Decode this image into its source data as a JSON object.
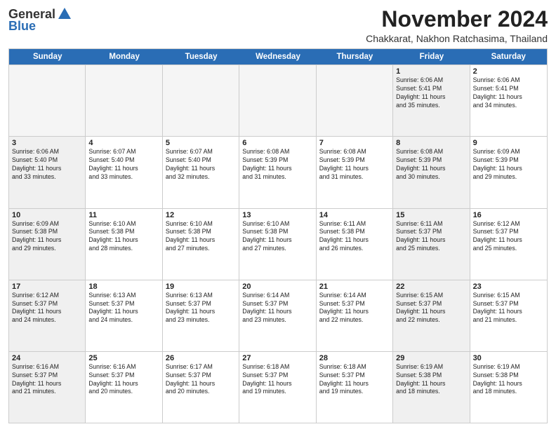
{
  "header": {
    "logo_line1": "General",
    "logo_line2": "Blue",
    "month": "November 2024",
    "location": "Chakkarat, Nakhon Ratchasima, Thailand"
  },
  "weekdays": [
    "Sunday",
    "Monday",
    "Tuesday",
    "Wednesday",
    "Thursday",
    "Friday",
    "Saturday"
  ],
  "rows": [
    [
      {
        "day": "",
        "info": "",
        "empty": true
      },
      {
        "day": "",
        "info": "",
        "empty": true
      },
      {
        "day": "",
        "info": "",
        "empty": true
      },
      {
        "day": "",
        "info": "",
        "empty": true
      },
      {
        "day": "",
        "info": "",
        "empty": true
      },
      {
        "day": "1",
        "info": "Sunrise: 6:06 AM\nSunset: 5:41 PM\nDaylight: 11 hours\nand 35 minutes.",
        "shaded": true
      },
      {
        "day": "2",
        "info": "Sunrise: 6:06 AM\nSunset: 5:41 PM\nDaylight: 11 hours\nand 34 minutes.",
        "shaded": false
      }
    ],
    [
      {
        "day": "3",
        "info": "Sunrise: 6:06 AM\nSunset: 5:40 PM\nDaylight: 11 hours\nand 33 minutes.",
        "shaded": true
      },
      {
        "day": "4",
        "info": "Sunrise: 6:07 AM\nSunset: 5:40 PM\nDaylight: 11 hours\nand 33 minutes.",
        "shaded": false
      },
      {
        "day": "5",
        "info": "Sunrise: 6:07 AM\nSunset: 5:40 PM\nDaylight: 11 hours\nand 32 minutes.",
        "shaded": false
      },
      {
        "day": "6",
        "info": "Sunrise: 6:08 AM\nSunset: 5:39 PM\nDaylight: 11 hours\nand 31 minutes.",
        "shaded": false
      },
      {
        "day": "7",
        "info": "Sunrise: 6:08 AM\nSunset: 5:39 PM\nDaylight: 11 hours\nand 31 minutes.",
        "shaded": false
      },
      {
        "day": "8",
        "info": "Sunrise: 6:08 AM\nSunset: 5:39 PM\nDaylight: 11 hours\nand 30 minutes.",
        "shaded": true
      },
      {
        "day": "9",
        "info": "Sunrise: 6:09 AM\nSunset: 5:39 PM\nDaylight: 11 hours\nand 29 minutes.",
        "shaded": false
      }
    ],
    [
      {
        "day": "10",
        "info": "Sunrise: 6:09 AM\nSunset: 5:38 PM\nDaylight: 11 hours\nand 29 minutes.",
        "shaded": true
      },
      {
        "day": "11",
        "info": "Sunrise: 6:10 AM\nSunset: 5:38 PM\nDaylight: 11 hours\nand 28 minutes.",
        "shaded": false
      },
      {
        "day": "12",
        "info": "Sunrise: 6:10 AM\nSunset: 5:38 PM\nDaylight: 11 hours\nand 27 minutes.",
        "shaded": false
      },
      {
        "day": "13",
        "info": "Sunrise: 6:10 AM\nSunset: 5:38 PM\nDaylight: 11 hours\nand 27 minutes.",
        "shaded": false
      },
      {
        "day": "14",
        "info": "Sunrise: 6:11 AM\nSunset: 5:38 PM\nDaylight: 11 hours\nand 26 minutes.",
        "shaded": false
      },
      {
        "day": "15",
        "info": "Sunrise: 6:11 AM\nSunset: 5:37 PM\nDaylight: 11 hours\nand 25 minutes.",
        "shaded": true
      },
      {
        "day": "16",
        "info": "Sunrise: 6:12 AM\nSunset: 5:37 PM\nDaylight: 11 hours\nand 25 minutes.",
        "shaded": false
      }
    ],
    [
      {
        "day": "17",
        "info": "Sunrise: 6:12 AM\nSunset: 5:37 PM\nDaylight: 11 hours\nand 24 minutes.",
        "shaded": true
      },
      {
        "day": "18",
        "info": "Sunrise: 6:13 AM\nSunset: 5:37 PM\nDaylight: 11 hours\nand 24 minutes.",
        "shaded": false
      },
      {
        "day": "19",
        "info": "Sunrise: 6:13 AM\nSunset: 5:37 PM\nDaylight: 11 hours\nand 23 minutes.",
        "shaded": false
      },
      {
        "day": "20",
        "info": "Sunrise: 6:14 AM\nSunset: 5:37 PM\nDaylight: 11 hours\nand 23 minutes.",
        "shaded": false
      },
      {
        "day": "21",
        "info": "Sunrise: 6:14 AM\nSunset: 5:37 PM\nDaylight: 11 hours\nand 22 minutes.",
        "shaded": false
      },
      {
        "day": "22",
        "info": "Sunrise: 6:15 AM\nSunset: 5:37 PM\nDaylight: 11 hours\nand 22 minutes.",
        "shaded": true
      },
      {
        "day": "23",
        "info": "Sunrise: 6:15 AM\nSunset: 5:37 PM\nDaylight: 11 hours\nand 21 minutes.",
        "shaded": false
      }
    ],
    [
      {
        "day": "24",
        "info": "Sunrise: 6:16 AM\nSunset: 5:37 PM\nDaylight: 11 hours\nand 21 minutes.",
        "shaded": true
      },
      {
        "day": "25",
        "info": "Sunrise: 6:16 AM\nSunset: 5:37 PM\nDaylight: 11 hours\nand 20 minutes.",
        "shaded": false
      },
      {
        "day": "26",
        "info": "Sunrise: 6:17 AM\nSunset: 5:37 PM\nDaylight: 11 hours\nand 20 minutes.",
        "shaded": false
      },
      {
        "day": "27",
        "info": "Sunrise: 6:18 AM\nSunset: 5:37 PM\nDaylight: 11 hours\nand 19 minutes.",
        "shaded": false
      },
      {
        "day": "28",
        "info": "Sunrise: 6:18 AM\nSunset: 5:37 PM\nDaylight: 11 hours\nand 19 minutes.",
        "shaded": false
      },
      {
        "day": "29",
        "info": "Sunrise: 6:19 AM\nSunset: 5:38 PM\nDaylight: 11 hours\nand 18 minutes.",
        "shaded": true
      },
      {
        "day": "30",
        "info": "Sunrise: 6:19 AM\nSunset: 5:38 PM\nDaylight: 11 hours\nand 18 minutes.",
        "shaded": false
      }
    ]
  ]
}
